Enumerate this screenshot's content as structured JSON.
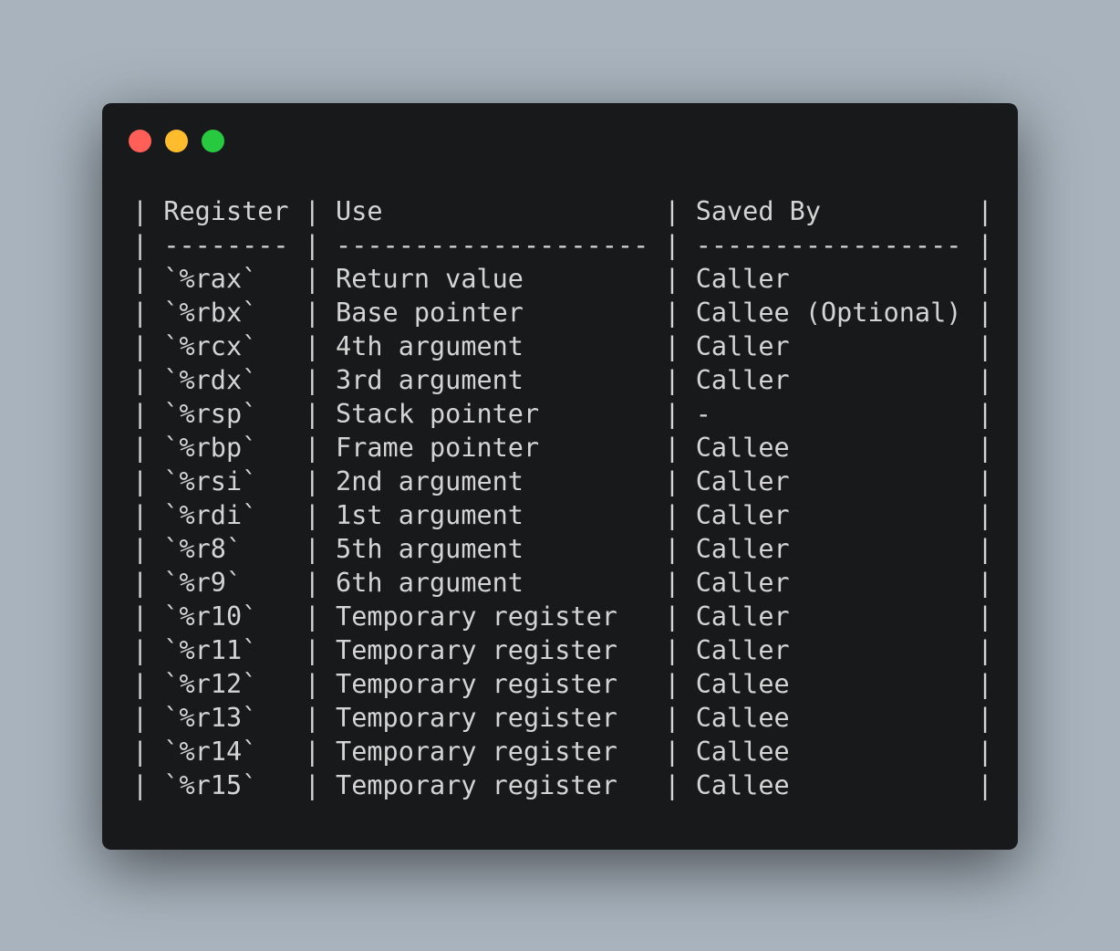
{
  "window": {
    "controls": [
      "close",
      "minimize",
      "maximize"
    ]
  },
  "code": {
    "lines": [
      "| Register | Use                  | Saved By          |",
      "| -------- | -------------------- | ----------------- |",
      "| `%rax`   | Return value         | Caller            |",
      "| `%rbx`   | Base pointer         | Callee (Optional) |",
      "| `%rcx`   | 4th argument         | Caller            |",
      "| `%rdx`   | 3rd argument         | Caller            |",
      "| `%rsp`   | Stack pointer        | -                 |",
      "| `%rbp`   | Frame pointer        | Callee            |",
      "| `%rsi`   | 2nd argument         | Caller            |",
      "| `%rdi`   | 1st argument         | Caller            |",
      "| `%r8`    | 5th argument         | Caller            |",
      "| `%r9`    | 6th argument         | Caller            |",
      "| `%r10`   | Temporary register   | Caller            |",
      "| `%r11`   | Temporary register   | Caller            |",
      "| `%r12`   | Temporary register   | Callee            |",
      "| `%r13`   | Temporary register   | Callee            |",
      "| `%r14`   | Temporary register   | Callee            |",
      "| `%r15`   | Temporary register   | Callee            |"
    ]
  }
}
